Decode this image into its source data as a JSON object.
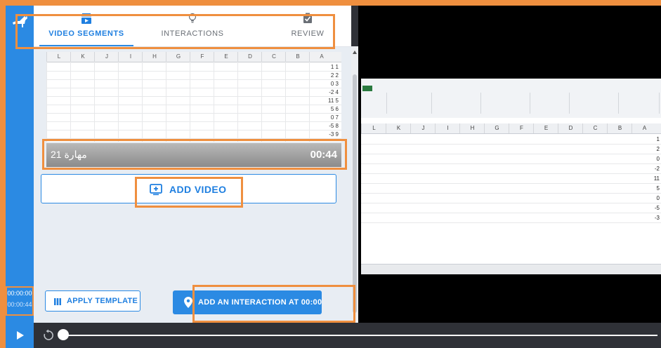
{
  "tabs": [
    {
      "label": "VIDEO SEGMENTS",
      "icon": "video-segments-icon",
      "active": true
    },
    {
      "label": "INTERACTIONS",
      "icon": "lightbulb-icon",
      "active": false
    },
    {
      "label": "REVIEW",
      "icon": "clipboard-check-icon",
      "active": false
    }
  ],
  "segment": {
    "title": "مهارة 21",
    "duration": "00:44"
  },
  "add_video": {
    "label": "ADD VIDEO",
    "icon": "add-video-icon"
  },
  "apply_template": {
    "label": "APPLY TEMPLATE",
    "icon": "template-columns-icon"
  },
  "add_interaction": {
    "label": "ADD AN INTERACTION AT 00:00",
    "icon": "location-pin-icon"
  },
  "time_display": {
    "current": "00:00:00",
    "total": "00:00:44"
  },
  "thumbnail": {
    "columns": [
      "L",
      "K",
      "J",
      "I",
      "H",
      "G",
      "F",
      "E",
      "D",
      "C",
      "B",
      "A"
    ],
    "row_values": [
      "1 1",
      "2 2",
      "0 3",
      "-2 4",
      "11 5",
      "5 6",
      "0 7",
      "-5 8",
      "-3 9"
    ]
  },
  "video_frame": {
    "columns": [
      "L",
      "K",
      "J",
      "I",
      "H",
      "G",
      "F",
      "E",
      "D",
      "C",
      "B",
      "A"
    ],
    "values": [
      "1",
      "2",
      "0",
      "-2",
      "11",
      "5",
      "0",
      "-5",
      "-3"
    ]
  },
  "player": {
    "progress": 0.0
  },
  "colors": {
    "accent": "#2b8ae3",
    "highlight": "#ef8f3f"
  }
}
